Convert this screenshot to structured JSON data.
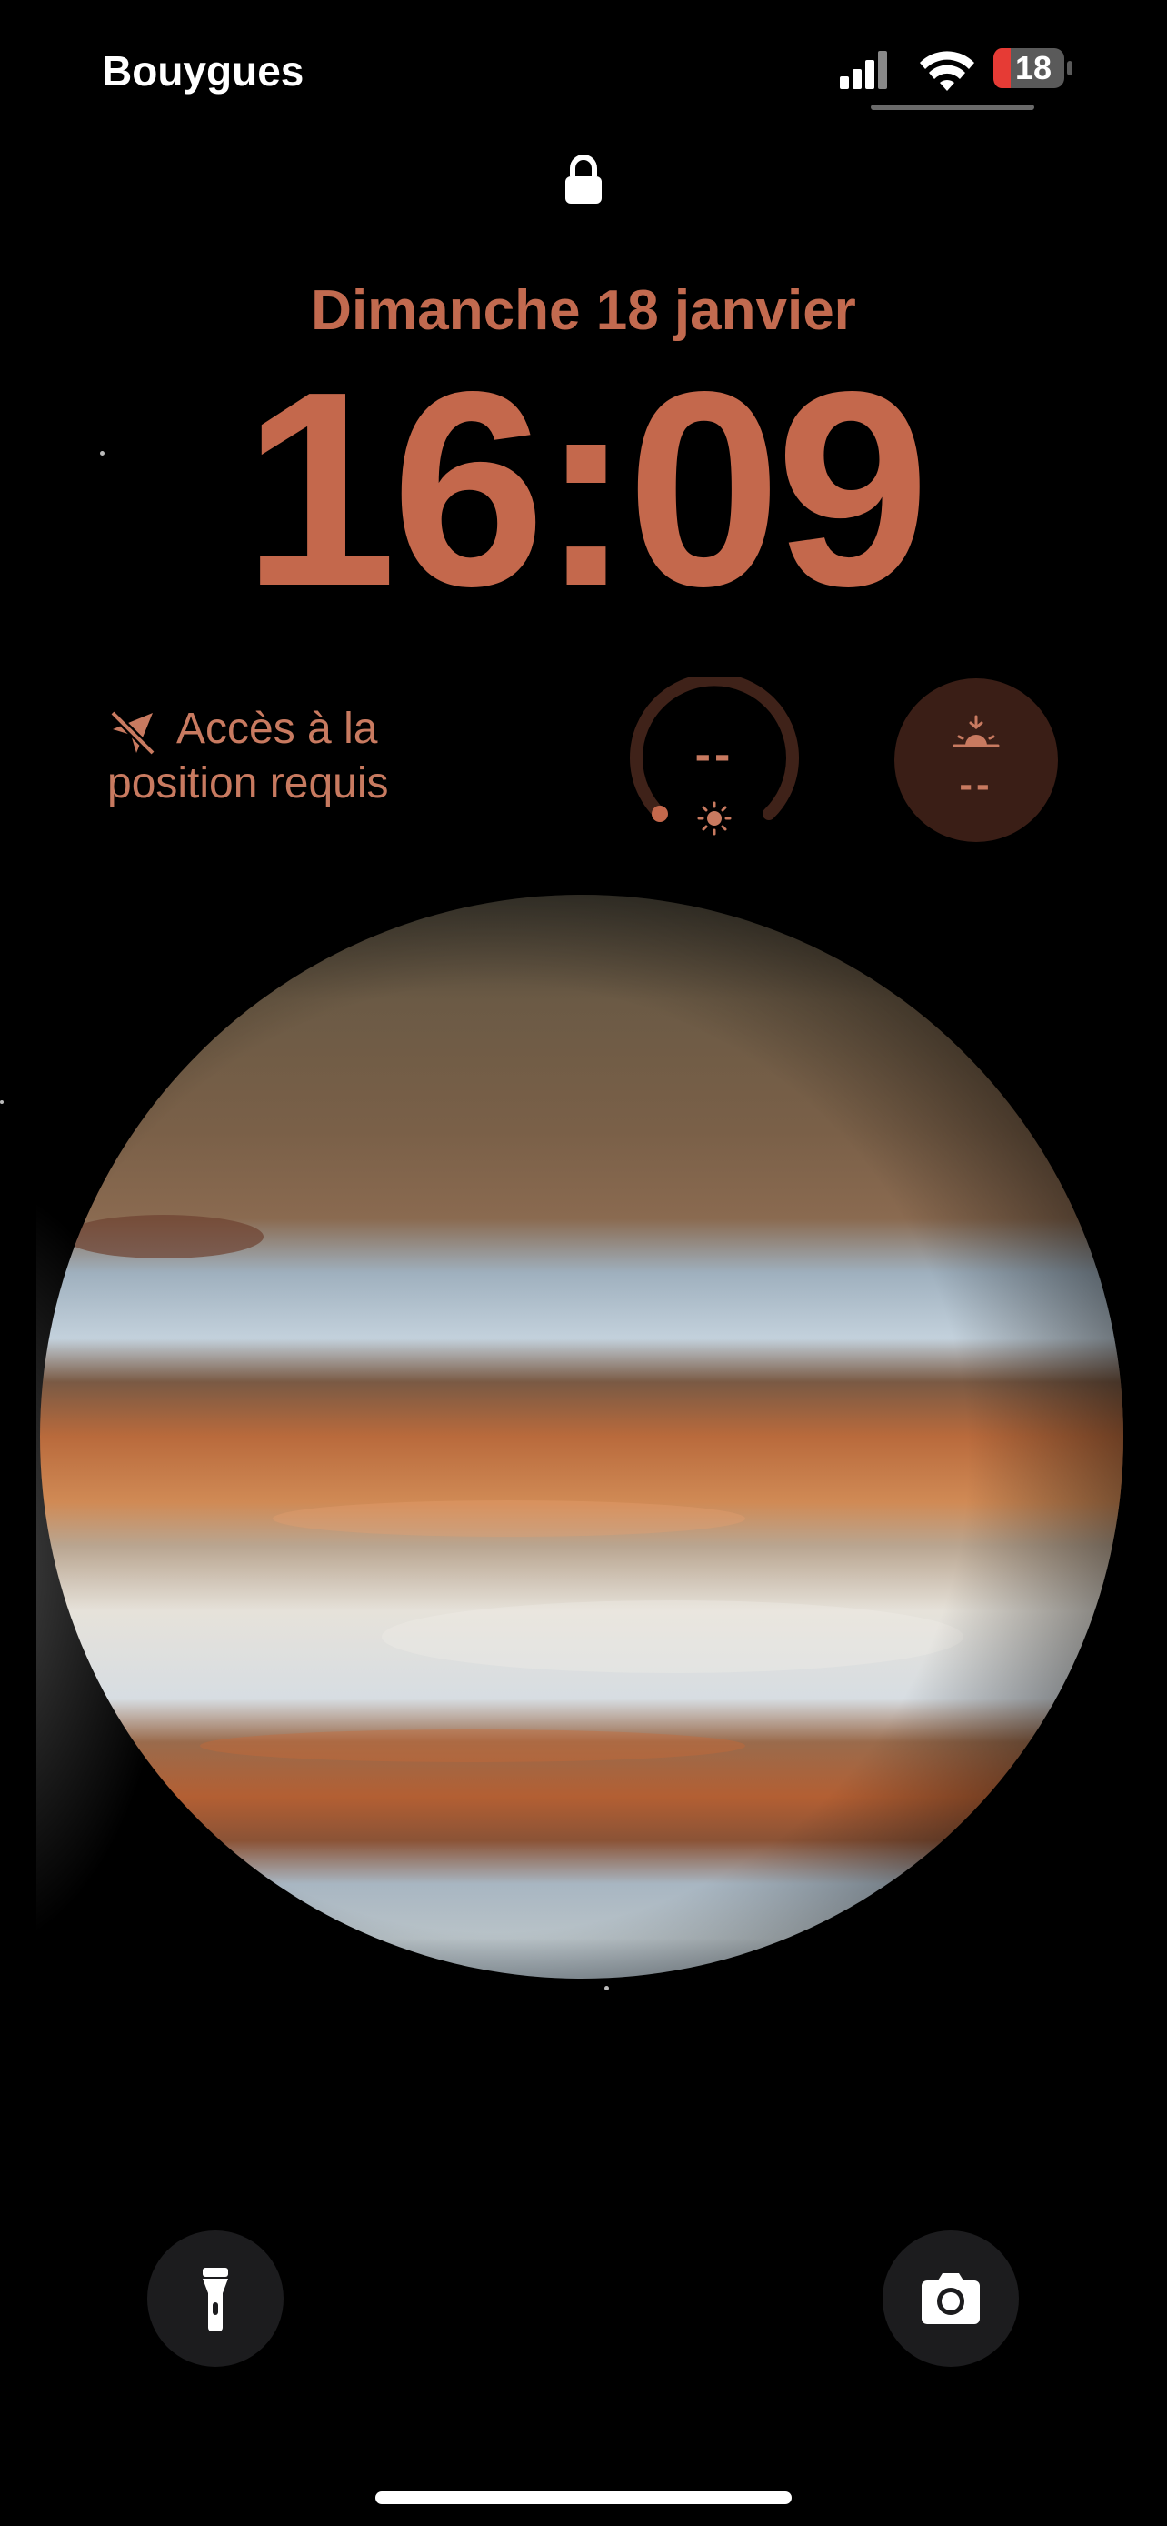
{
  "status_bar": {
    "carrier": "Bouygues",
    "battery_level": "18",
    "icons": [
      "cellular-signal-icon",
      "wifi-icon",
      "battery-icon"
    ]
  },
  "lock_screen": {
    "lock_icon": "lock-icon",
    "date": "Dimanche 18 janvier",
    "time": "16:09",
    "accent_color": "#c4684c"
  },
  "widgets": {
    "location": {
      "icon": "location-slash-icon",
      "line1": "Accès à la",
      "line2": "position requis"
    },
    "uv_index": {
      "icon": "sun-icon",
      "value": "--"
    },
    "sunset": {
      "icon": "sunset-icon",
      "value": "--"
    }
  },
  "wallpaper": {
    "subject": "planet-jupiter"
  },
  "bottom_controls": {
    "flashlight_icon": "flashlight-icon",
    "camera_icon": "camera-icon"
  }
}
